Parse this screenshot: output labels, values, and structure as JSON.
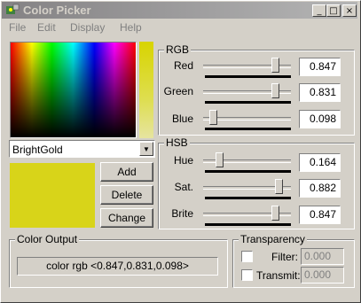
{
  "window": {
    "title": "Color Picker",
    "controls": {
      "minimize": "_",
      "maximize": "□",
      "close": "×"
    }
  },
  "menu": [
    "File",
    "Edit",
    "Display",
    "Help"
  ],
  "color_name": "BrightGold",
  "actions": {
    "add": "Add",
    "delete": "Delete",
    "change": "Change"
  },
  "rgb": {
    "label": "RGB",
    "channels": [
      {
        "label": "Red",
        "value": "0.847"
      },
      {
        "label": "Green",
        "value": "0.831"
      },
      {
        "label": "Blue",
        "value": "0.098"
      }
    ]
  },
  "hsb": {
    "label": "HSB",
    "channels": [
      {
        "label": "Hue",
        "value": "0.164"
      },
      {
        "label": "Sat.",
        "value": "0.882"
      },
      {
        "label": "Brite",
        "value": "0.847"
      }
    ]
  },
  "output": {
    "label": "Color Output",
    "text": "color rgb <0.847,0.831,0.098>"
  },
  "transparency": {
    "label": "Transparency",
    "filter_label": "Filter:",
    "filter_value": "0.000",
    "transmit_label": "Transmit:",
    "transmit_value": "0.000"
  },
  "colors": {
    "swatch": "#d8d419",
    "title_text": "#d4d0c8"
  }
}
